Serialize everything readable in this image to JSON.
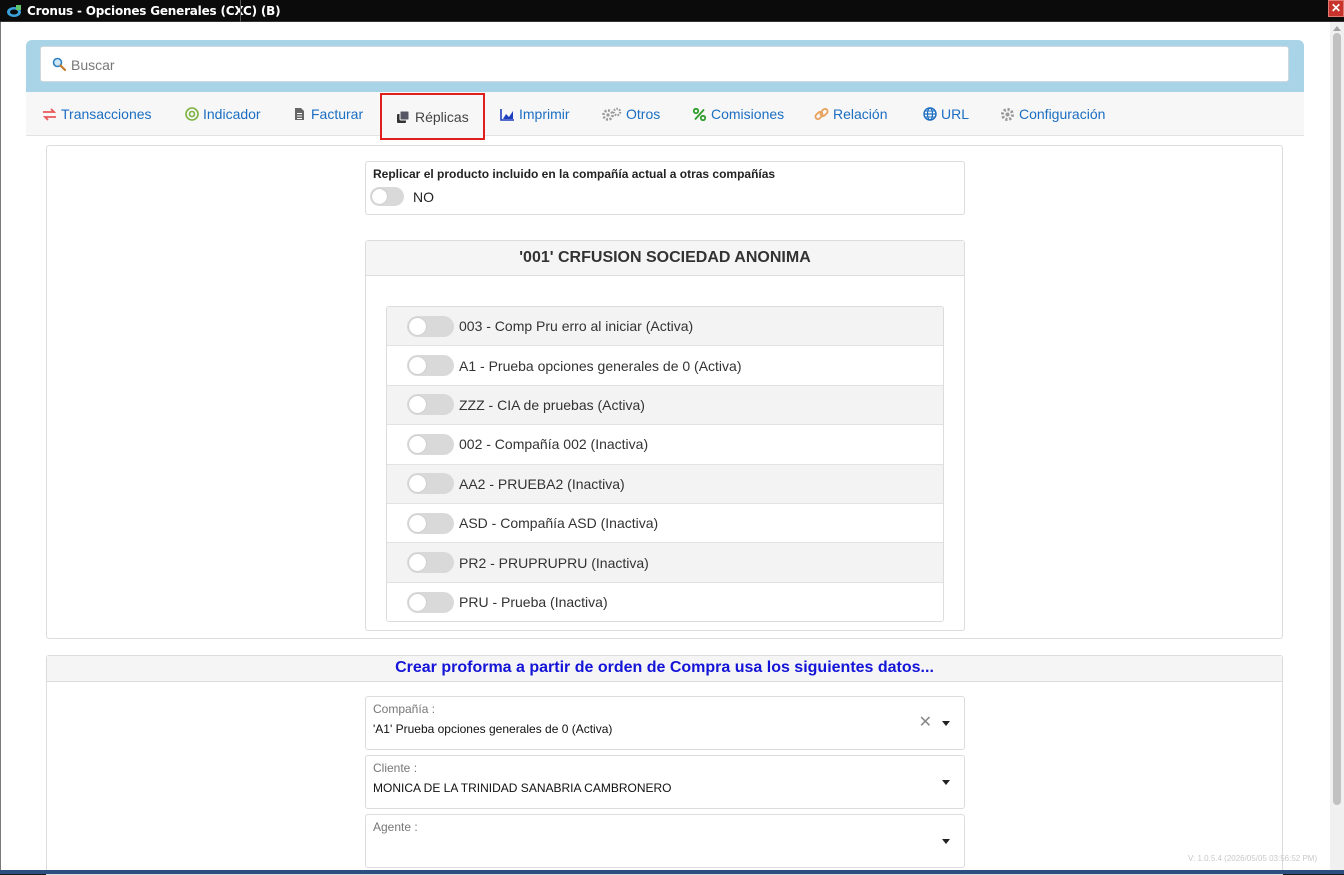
{
  "window": {
    "title": "Cronus - Opciones Generales (CXC) (B)",
    "close_label": "✕"
  },
  "search": {
    "placeholder": "Buscar"
  },
  "tabs": [
    {
      "label": "Transacciones",
      "icon": "arrows-exchange-icon",
      "color": "#e8585a"
    },
    {
      "label": "Indicador",
      "icon": "target-icon",
      "color": "#7cb342"
    },
    {
      "label": "Facturar",
      "icon": "document-icon",
      "color": "#555555"
    },
    {
      "label": "Réplicas",
      "icon": "copy-icon",
      "color": "#333333",
      "active": true
    },
    {
      "label": "Imprimir",
      "icon": "area-chart-icon",
      "color": "#1f3fbf"
    },
    {
      "label": "Otros",
      "icon": "gears-icon",
      "color": "#8a8a8a"
    },
    {
      "label": "Comisiones",
      "icon": "percent-icon",
      "color": "#2e9e2e"
    },
    {
      "label": "Relación",
      "icon": "link-icon",
      "color": "#e8a15a"
    },
    {
      "label": "URL",
      "icon": "globe-icon",
      "color": "#1b6ec2"
    },
    {
      "label": "Configuración",
      "icon": "gear-icon",
      "color": "#8a8a8a"
    }
  ],
  "replicate": {
    "label": "Replicar el producto incluido en la compañía actual a otras compañías",
    "value": "NO",
    "enabled": false
  },
  "company": {
    "header": "'001' CRFUSION SOCIEDAD ANONIMA",
    "items": [
      {
        "label": "003 - Comp Pru erro al iniciar (Activa)",
        "enabled": false
      },
      {
        "label": "A1 - Prueba opciones generales de 0 (Activa)",
        "enabled": false
      },
      {
        "label": "ZZZ - CIA de pruebas (Activa)",
        "enabled": false
      },
      {
        "label": "002 - Compañía 002 (Inactiva)",
        "enabled": false
      },
      {
        "label": "AA2 - PRUEBA2 (Inactiva)",
        "enabled": false
      },
      {
        "label": "ASD - Compañía ASD (Inactiva)",
        "enabled": false
      },
      {
        "label": "PR2 - PRUPRUPRU (Inactiva)",
        "enabled": false
      },
      {
        "label": "PRU - Prueba (Inactiva)",
        "enabled": false
      }
    ]
  },
  "proforma": {
    "header": "Crear proforma a partir de orden de Compra usa los siguientes datos...",
    "fields": [
      {
        "label": "Compañía :",
        "value": "'A1' Prueba opciones generales de 0 (Activa)",
        "clearable": true
      },
      {
        "label": "Cliente :",
        "value": "MONICA DE LA TRINIDAD SANABRIA CAMBRONERO",
        "clearable": false
      },
      {
        "label": "Agente :",
        "value": "",
        "clearable": false
      }
    ]
  },
  "version": "V: 1.0.5.4 (2026/05/05 03:56:52 PM)"
}
